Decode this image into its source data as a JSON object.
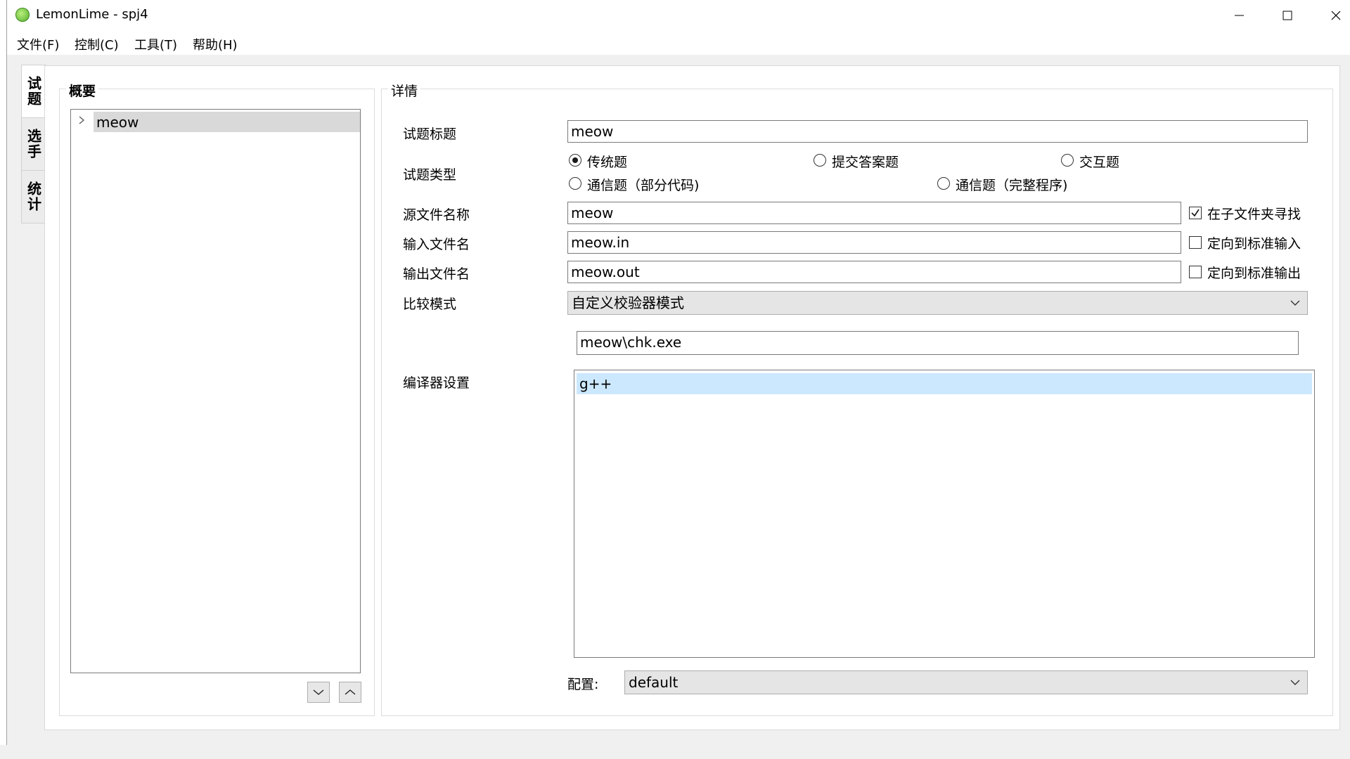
{
  "window": {
    "title": "LemonLime - spj4"
  },
  "menu": [
    "文件(F)",
    "控制(C)",
    "工具(T)",
    "帮助(H)"
  ],
  "side_tabs": [
    {
      "label": "试题",
      "active": true
    },
    {
      "label": "选手",
      "active": false
    },
    {
      "label": "统计",
      "active": false
    }
  ],
  "summary": {
    "title": "概要",
    "tree_items": [
      "meow"
    ]
  },
  "details": {
    "title": "详情",
    "problem_title": {
      "label": "试题标题",
      "value": "meow"
    },
    "problem_type": {
      "label": "试题类型",
      "options": [
        "传统题",
        "提交答案题",
        "交互题",
        "通信题（部分代码)",
        "通信题（完整程序)"
      ],
      "selected": "传统题"
    },
    "source_file": {
      "label": "源文件名称",
      "value": "meow",
      "checkbox_label": "在子文件夹寻找",
      "checked": true
    },
    "input_file": {
      "label": "输入文件名",
      "value": "meow.in",
      "checkbox_label": "定向到标准输入",
      "checked": false
    },
    "output_file": {
      "label": "输出文件名",
      "value": "meow.out",
      "checkbox_label": "定向到标准输出",
      "checked": false
    },
    "compare_mode": {
      "label": "比较模式",
      "value": "自定义校验器模式"
    },
    "checker_path": {
      "value": "meow\\chk.exe"
    },
    "compiler": {
      "label": "编译器设置",
      "items": [
        "g++"
      ]
    },
    "config": {
      "label": "配置:",
      "value": "default"
    }
  }
}
